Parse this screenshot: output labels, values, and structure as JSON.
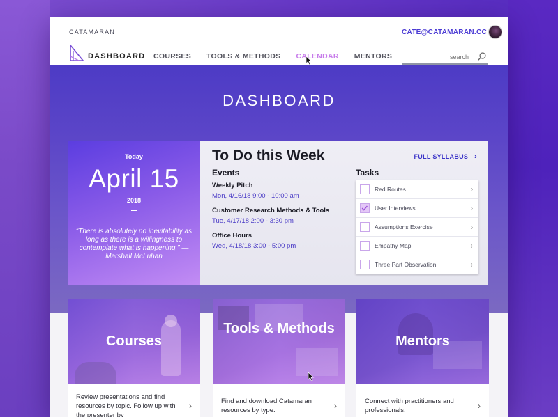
{
  "header": {
    "brand": "CATAMARAN",
    "account": "CATE@CATAMARAN.CC",
    "logo_text": "DASHBOARD",
    "nav": [
      "COURSES",
      "TOOLS & METHODS",
      "CALENDAR",
      "MENTORS"
    ],
    "active_nav": "CALENDAR",
    "search_placeholder": "search"
  },
  "hero": {
    "title": "DASHBOARD"
  },
  "today": {
    "label": "Today",
    "date": "April 15",
    "year": "2018",
    "quote": "“There is absolutely no inevitability as long as there is a willingness to contemplate what is happening.” — Marshall McLuhan"
  },
  "todo": {
    "title": "To Do this Week",
    "syllabus_label": "FULL SYLLABUS",
    "events_heading": "Events",
    "events": [
      {
        "name": "Weekly Pitch",
        "time": "Mon, 4/16/18 9:00 - 10:00 am"
      },
      {
        "name": "Customer Research Methods & Tools",
        "time": "Tue, 4/17/18 2:00 - 3:30 pm"
      },
      {
        "name": "Office Hours",
        "time": "Wed, 4/18/18 3:00 - 5:00 pm"
      }
    ],
    "tasks_heading": "Tasks",
    "tasks": [
      {
        "label": "Red Routes",
        "checked": false
      },
      {
        "label": "User Interviews",
        "checked": true
      },
      {
        "label": "Assumptions Exercise",
        "checked": false
      },
      {
        "label": "Empathy Map",
        "checked": false
      },
      {
        "label": "Three Part Observation",
        "checked": false
      }
    ]
  },
  "cards": [
    {
      "title": "Courses",
      "desc": "Review presentations and find resources by topic. Follow up with the presenter by"
    },
    {
      "title": "Tools & Methods",
      "desc": "Find and download Catamaran resources by type."
    },
    {
      "title": "Mentors",
      "desc": "Connect with practitioners and professionals."
    }
  ],
  "colors": {
    "accent": "#4b3bd4",
    "active_nav": "#c77bea",
    "hero": "#5c46c8"
  }
}
